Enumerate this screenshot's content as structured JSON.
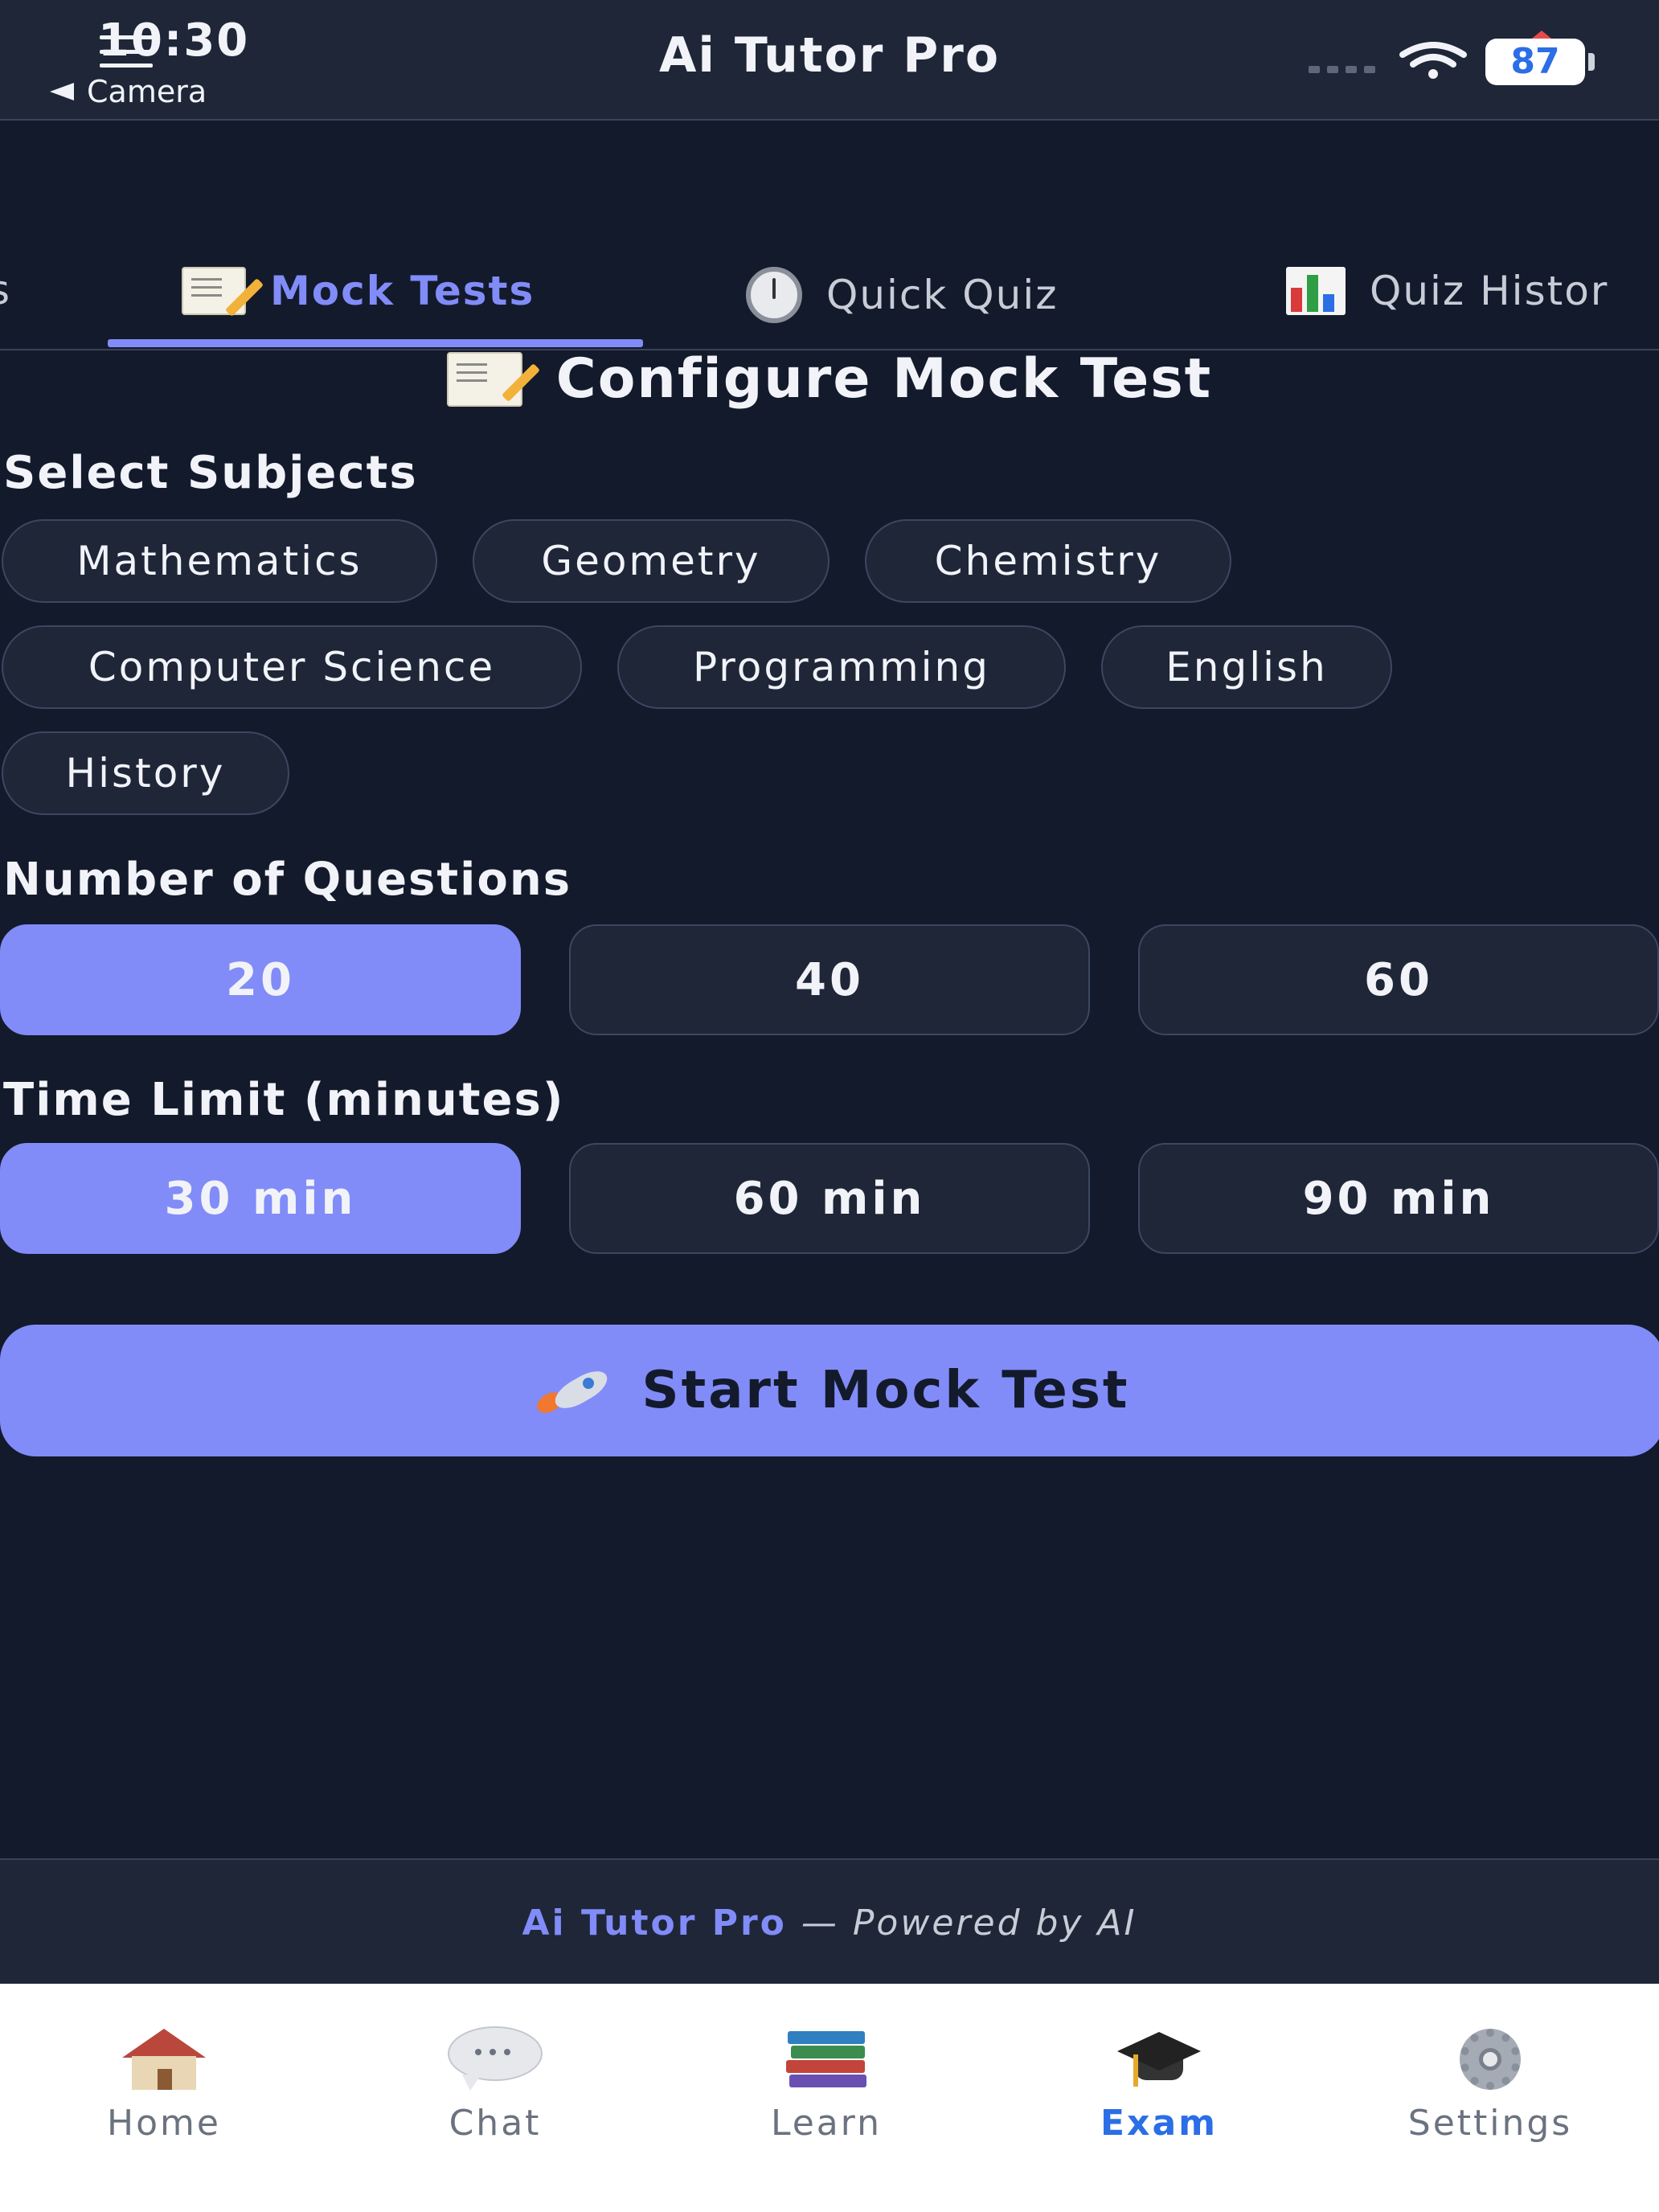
{
  "status_bar": {
    "time": "10:30",
    "back_label": "Camera",
    "app_title": "Ai Tutor Pro",
    "battery_level": "87"
  },
  "tabs": [
    {
      "label": "s",
      "icon": "none",
      "active": false
    },
    {
      "label": "Mock Tests",
      "icon": "memo-icon",
      "active": true
    },
    {
      "label": "Quick Quiz",
      "icon": "stopwatch-icon",
      "active": false
    },
    {
      "label": "Quiz Histor",
      "icon": "chart-icon",
      "active": false
    }
  ],
  "config": {
    "title": "Configure Mock Test",
    "subjects_label": "Select Subjects",
    "subjects": [
      "Mathematics",
      "Geometry",
      "Chemistry",
      "Computer Science",
      "Programming",
      "English",
      "History"
    ],
    "questions_label": "Number of Questions",
    "question_options": [
      "20",
      "40",
      "60"
    ],
    "questions_selected": "20",
    "time_label": "Time Limit (minutes)",
    "time_options": [
      "30 min",
      "60 min",
      "90 min"
    ],
    "time_selected": "30 min",
    "start_label": "Start Mock Test"
  },
  "footer": {
    "brand": "Ai Tutor Pro",
    "powered": "— Powered by AI"
  },
  "bottom_nav": [
    {
      "label": "Home",
      "icon": "house-icon",
      "active": false
    },
    {
      "label": "Chat",
      "icon": "chat-bubble-icon",
      "active": false
    },
    {
      "label": "Learn",
      "icon": "books-icon",
      "active": false
    },
    {
      "label": "Exam",
      "icon": "graduation-cap-icon",
      "active": true
    },
    {
      "label": "Settings",
      "icon": "gear-icon",
      "active": false
    }
  ],
  "colors": {
    "background": "#131a2b",
    "surface": "#1e2638",
    "accent": "#818cf8",
    "nav_active": "#2b6ee5"
  }
}
